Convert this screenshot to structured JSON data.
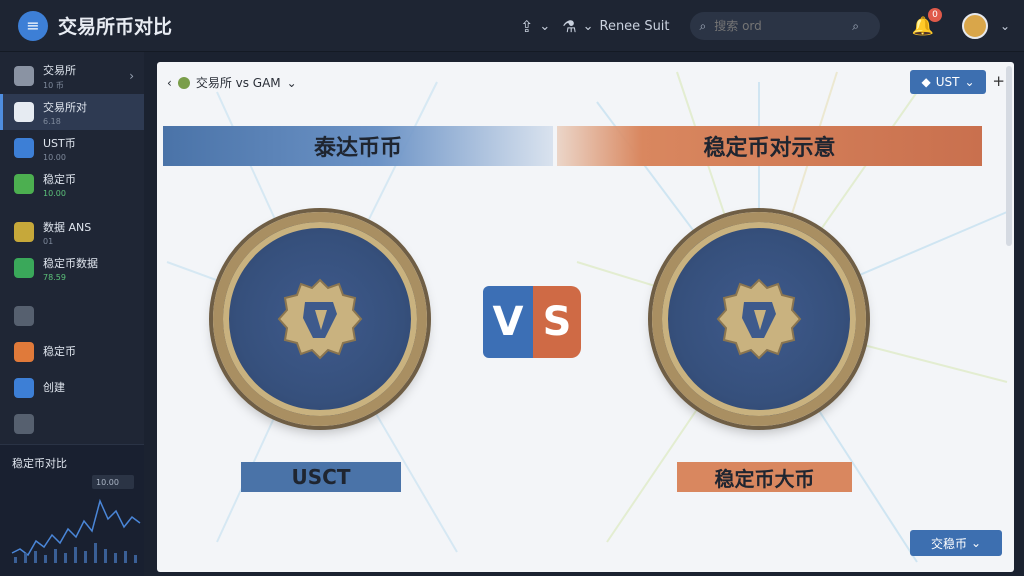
{
  "app": {
    "title": "交易所币对比",
    "menu_icon": "hamburger-icon"
  },
  "topbar": {
    "share_icon": "share-icon",
    "tool_icon": "tool-icon",
    "user_label": "Renee Suit",
    "search_placeholder": "搜索 ord",
    "notification_count": "0"
  },
  "sidebar": {
    "items": [
      {
        "label": "交易所",
        "sub": "10 币",
        "icon": "wallet-icon",
        "color": "#8a93a3"
      },
      {
        "label": "交易所对",
        "sub": "6.18",
        "icon": "exchange-icon",
        "color": "#e6ebf2",
        "active": true
      },
      {
        "label": "UST币",
        "sub": "10.00",
        "icon": "ust-icon",
        "color": "#3d7fd6"
      },
      {
        "label": "稳定币",
        "sub": "10.00",
        "icon": "stable-icon",
        "color": "#4caf50",
        "sub_green": true
      },
      {
        "label": "数据 ANS",
        "sub": "01",
        "icon": "cube-icon",
        "color": "#c6a83a"
      },
      {
        "label": "稳定币数据",
        "sub": "78.59",
        "icon": "shield-icon",
        "color": "#3aa85a",
        "sub_green": true
      },
      {
        "label": "",
        "sub": "",
        "icon": "trash-icon",
        "color": "#56606f"
      },
      {
        "label": "稳定币",
        "sub": "",
        "icon": "coin-icon",
        "color": "#e07a3a"
      },
      {
        "label": "创建",
        "sub": "",
        "icon": "chart-bars-icon",
        "color": "#3d7fd6"
      },
      {
        "label": "",
        "sub": "",
        "icon": "settings-icon",
        "color": "#56606f"
      }
    ],
    "chart_title": "稳定币对比",
    "chart_tag": "10.00"
  },
  "main": {
    "breadcrumb": "交易所 vs GAM",
    "ust_button": "UST",
    "plus": "+",
    "banner_left": "泰达币币",
    "banner_right": "稳定币对示意",
    "vs_v": "V",
    "vs_s": "S",
    "label_left": "USCT",
    "label_right": "稳定币大币",
    "bottom_button": "交稳币"
  }
}
